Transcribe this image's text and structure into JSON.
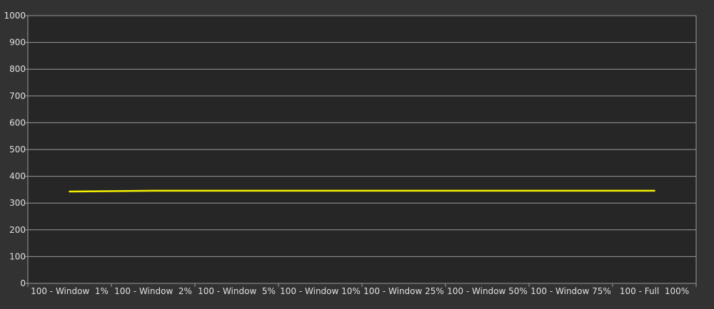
{
  "chart_data": {
    "type": "line",
    "title": "",
    "xlabel": "",
    "ylabel": "",
    "ylim": [
      0,
      1000
    ],
    "yticks": [
      0,
      100,
      200,
      300,
      400,
      500,
      600,
      700,
      800,
      900,
      1000
    ],
    "grid": true,
    "categories": [
      "100 - Window  1%",
      "100 - Window  2%",
      "100 - Window  5%",
      "100 - Window 10%",
      "100 - Window 25%",
      "100 - Window 50%",
      "100 - Window 75%",
      "100 - Full  100%"
    ],
    "series": [
      {
        "values": [
          343,
          346,
          346,
          346,
          346,
          346,
          346,
          346
        ],
        "color": "#f4f000"
      }
    ],
    "colors": {
      "background": "#323232",
      "plot_background": "#262626",
      "grid": "#9a9a9a",
      "text": "#e0e0e0"
    }
  }
}
